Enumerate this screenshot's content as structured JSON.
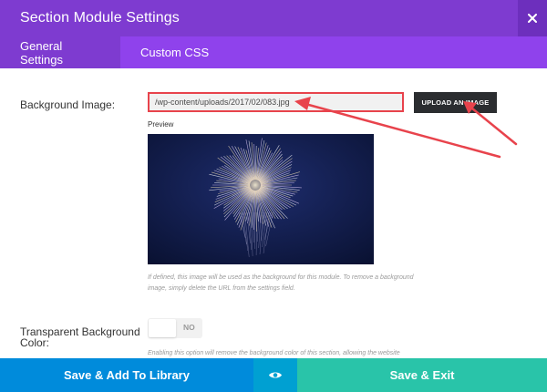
{
  "header": {
    "title": "Section Module Settings",
    "close_icon": "close-icon",
    "bg_color": "#7e3bd0"
  },
  "tabs": [
    {
      "label": "General Settings",
      "active": true
    },
    {
      "label": "Custom CSS",
      "active": false
    }
  ],
  "background_image": {
    "label": "Background Image:",
    "value": "/wp-content/uploads/2017/02/083.jpg",
    "upload_label": "UPLOAD AN IMAGE",
    "preview_label": "Preview",
    "help_text_line1": "If defined, this image will be used as the background for this module. To remove a background",
    "help_text_line2": "image, simply delete the URL from the settings field.",
    "highlight_color": "#e8434c"
  },
  "transparent_bg": {
    "label_line1": "Transparent Background",
    "label_line2": "Color:",
    "toggle_value": "NO",
    "help_text": "Enabling this option will remove the background color of this section, allowing the website"
  },
  "footer": {
    "save_library_label": "Save & Add To Library",
    "preview_icon": "eye-icon",
    "save_exit_label": "Save & Exit",
    "colors": {
      "library": "#008bdb",
      "preview": "#00a0d2",
      "exit": "#29c4a9"
    }
  }
}
